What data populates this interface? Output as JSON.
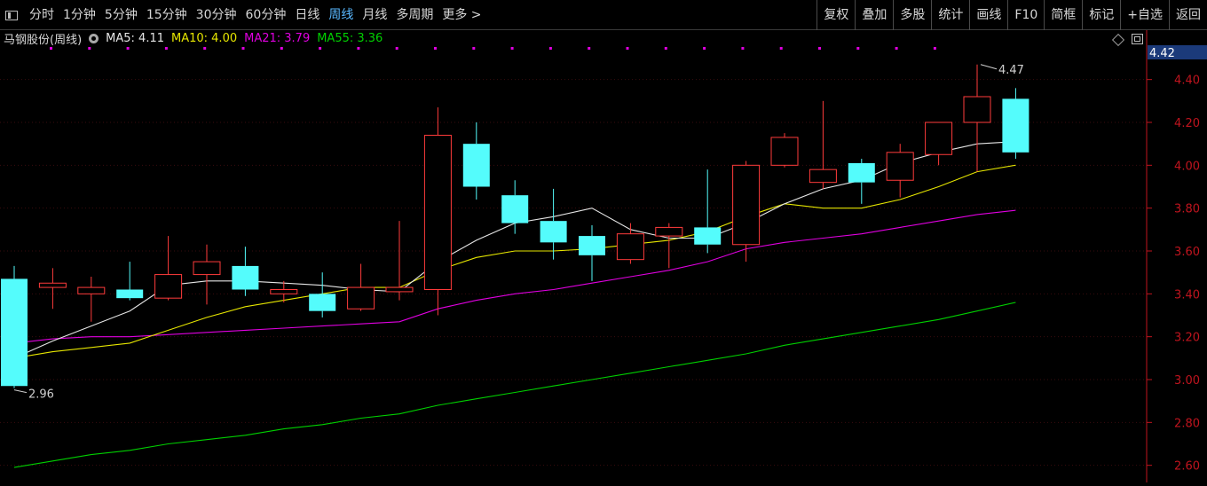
{
  "toolbar": {
    "tabs": [
      "分时",
      "1分钟",
      "5分钟",
      "15分钟",
      "30分钟",
      "60分钟",
      "日线",
      "周线",
      "月线",
      "多周期",
      "更多 >"
    ],
    "active_tab": "周线",
    "right_buttons": [
      "复权",
      "叠加",
      "多股",
      "统计",
      "画线",
      "F10",
      "简框",
      "标记",
      "+自选",
      "返回"
    ]
  },
  "legend": {
    "title": "马钢股份(周线)",
    "ma5": "MA5: 4.11",
    "ma10": "MA10: 4.00",
    "ma21": "MA21: 3.79",
    "ma55": "MA55: 3.36"
  },
  "colors": {
    "up": "#ff3b3b",
    "down": "#54fcfc",
    "ma5": "#e6e6e6",
    "ma10": "#e6e600",
    "ma21": "#e000e0",
    "ma55": "#00d000",
    "axis": "#c0141e",
    "current_price_bg": "#1b3a7a"
  },
  "price_axis": {
    "current_price": "4.42",
    "ticks": [
      "4.40",
      "4.20",
      "4.00",
      "3.80",
      "3.60",
      "3.40",
      "3.20",
      "3.00",
      "2.80",
      "2.60"
    ]
  },
  "annotations": {
    "high_label": "4.47",
    "low_label": "2.96"
  },
  "chart_data": {
    "type": "candlestick",
    "ylim": [
      2.52,
      4.56
    ],
    "candles": [
      {
        "open": 3.47,
        "high": 3.53,
        "low": 2.96,
        "close": 2.97
      },
      {
        "open": 3.43,
        "high": 3.52,
        "low": 3.33,
        "close": 3.45
      },
      {
        "open": 3.4,
        "high": 3.48,
        "low": 3.27,
        "close": 3.43
      },
      {
        "open": 3.42,
        "high": 3.55,
        "low": 3.37,
        "close": 3.38
      },
      {
        "open": 3.38,
        "high": 3.67,
        "low": 3.37,
        "close": 3.49
      },
      {
        "open": 3.49,
        "high": 3.63,
        "low": 3.35,
        "close": 3.55
      },
      {
        "open": 3.53,
        "high": 3.62,
        "low": 3.39,
        "close": 3.42
      },
      {
        "open": 3.4,
        "high": 3.46,
        "low": 3.36,
        "close": 3.42
      },
      {
        "open": 3.4,
        "high": 3.5,
        "low": 3.29,
        "close": 3.32
      },
      {
        "open": 3.33,
        "high": 3.54,
        "low": 3.32,
        "close": 3.43
      },
      {
        "open": 3.41,
        "high": 3.74,
        "low": 3.37,
        "close": 3.43
      },
      {
        "open": 3.42,
        "high": 4.27,
        "low": 3.3,
        "close": 4.14
      },
      {
        "open": 4.1,
        "high": 4.2,
        "low": 3.84,
        "close": 3.9
      },
      {
        "open": 3.86,
        "high": 3.93,
        "low": 3.68,
        "close": 3.73
      },
      {
        "open": 3.74,
        "high": 3.89,
        "low": 3.56,
        "close": 3.64
      },
      {
        "open": 3.67,
        "high": 3.72,
        "low": 3.46,
        "close": 3.58
      },
      {
        "open": 3.56,
        "high": 3.73,
        "low": 3.54,
        "close": 3.68
      },
      {
        "open": 3.67,
        "high": 3.73,
        "low": 3.52,
        "close": 3.71
      },
      {
        "open": 3.71,
        "high": 3.98,
        "low": 3.59,
        "close": 3.63
      },
      {
        "open": 3.63,
        "high": 4.02,
        "low": 3.55,
        "close": 4.0
      },
      {
        "open": 4.0,
        "high": 4.15,
        "low": 3.99,
        "close": 4.13
      },
      {
        "open": 3.92,
        "high": 4.3,
        "low": 3.89,
        "close": 3.98
      },
      {
        "open": 4.01,
        "high": 4.03,
        "low": 3.82,
        "close": 3.92
      },
      {
        "open": 3.93,
        "high": 4.1,
        "low": 3.85,
        "close": 4.06
      },
      {
        "open": 4.05,
        "high": 4.2,
        "low": 4.0,
        "close": 4.2
      },
      {
        "open": 4.2,
        "high": 4.47,
        "low": 3.97,
        "close": 4.32
      },
      {
        "open": 4.31,
        "high": 4.36,
        "low": 4.03,
        "close": 4.06
      }
    ],
    "ma5": [
      3.1,
      3.18,
      3.25,
      3.32,
      3.44,
      3.46,
      3.46,
      3.45,
      3.44,
      3.42,
      3.41,
      3.55,
      3.65,
      3.73,
      3.76,
      3.8,
      3.7,
      3.66,
      3.66,
      3.73,
      3.82,
      3.89,
      3.93,
      4.01,
      4.06,
      4.1,
      4.11
    ],
    "ma10": [
      3.1,
      3.13,
      3.15,
      3.17,
      3.23,
      3.29,
      3.34,
      3.37,
      3.4,
      3.43,
      3.43,
      3.51,
      3.57,
      3.6,
      3.6,
      3.61,
      3.63,
      3.65,
      3.69,
      3.76,
      3.82,
      3.8,
      3.8,
      3.84,
      3.9,
      3.97,
      4.0
    ],
    "ma21": [
      3.17,
      3.19,
      3.2,
      3.2,
      3.21,
      3.22,
      3.23,
      3.24,
      3.25,
      3.26,
      3.27,
      3.33,
      3.37,
      3.4,
      3.42,
      3.45,
      3.48,
      3.51,
      3.55,
      3.61,
      3.64,
      3.66,
      3.68,
      3.71,
      3.74,
      3.77,
      3.79
    ],
    "ma55": [
      2.59,
      2.62,
      2.65,
      2.67,
      2.7,
      2.72,
      2.74,
      2.77,
      2.79,
      2.82,
      2.84,
      2.88,
      2.91,
      2.94,
      2.97,
      3.0,
      3.03,
      3.06,
      3.09,
      3.12,
      3.16,
      3.19,
      3.22,
      3.25,
      3.28,
      3.32,
      3.36
    ]
  }
}
